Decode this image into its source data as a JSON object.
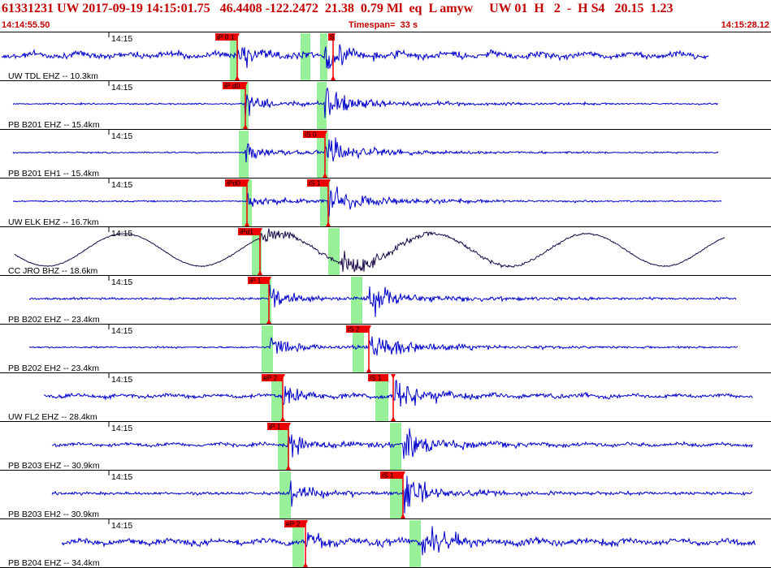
{
  "header": {
    "event_line": "61331231 UW 2017-09-19 14:15:01.75   46.4408 -122.2472  21.38  0.79 Ml  eq  L amyw     UW 01  H   2  -  H S4   20.15  1.23",
    "start_time": "14:14:55.50",
    "timespan": "Timespan=  33 s",
    "end_time": "14:15:28.12"
  },
  "colors": {
    "trace_blue": "#0000cc",
    "trace_dark": "#1a0a4a",
    "pick_red": "#ee0000",
    "window_green": "#98f098",
    "header_red": "#c40000"
  },
  "time_tick_label": "14:15",
  "channels": [
    {
      "label": "UW TDL EHZ -- 10.3km",
      "style": "blue",
      "picks": [
        "iP 0 1",
        "S"
      ]
    },
    {
      "label": "PB B201 EHZ -- 15.4km",
      "style": "blue",
      "picks": [
        "iP d0"
      ]
    },
    {
      "label": "PB B201 EH1 -- 15.4km",
      "style": "blue",
      "picks": [
        "iS 0"
      ]
    },
    {
      "label": "UW ELK EHZ -- 16.7km",
      "style": "blue",
      "picks": [
        "iPd0",
        "iS 1"
      ]
    },
    {
      "label": "CC JRO BHZ -- 18.6km",
      "style": "dark",
      "picks": [
        "iPd1"
      ]
    },
    {
      "label": "PB B202 EHZ -- 23.4km",
      "style": "blue",
      "picks": [
        "iP 1"
      ]
    },
    {
      "label": "PB B202 EH2 -- 23.4km",
      "style": "blue",
      "picks": [
        "iS 2"
      ]
    },
    {
      "label": "UW FL2 EHZ -- 28.4km",
      "style": "blue",
      "picks": [
        "eP 2",
        "iS 1"
      ]
    },
    {
      "label": "PB B203 EHZ -- 30.9km",
      "style": "blue",
      "picks": [
        "iP 1"
      ]
    },
    {
      "label": "PB B203 EH2 -- 30.9km",
      "style": "blue",
      "picks": [
        "iS 1"
      ]
    },
    {
      "label": "PB B204 EHZ -- 34.4km",
      "style": "blue",
      "picks": [
        "eP 2"
      ]
    }
  ]
}
